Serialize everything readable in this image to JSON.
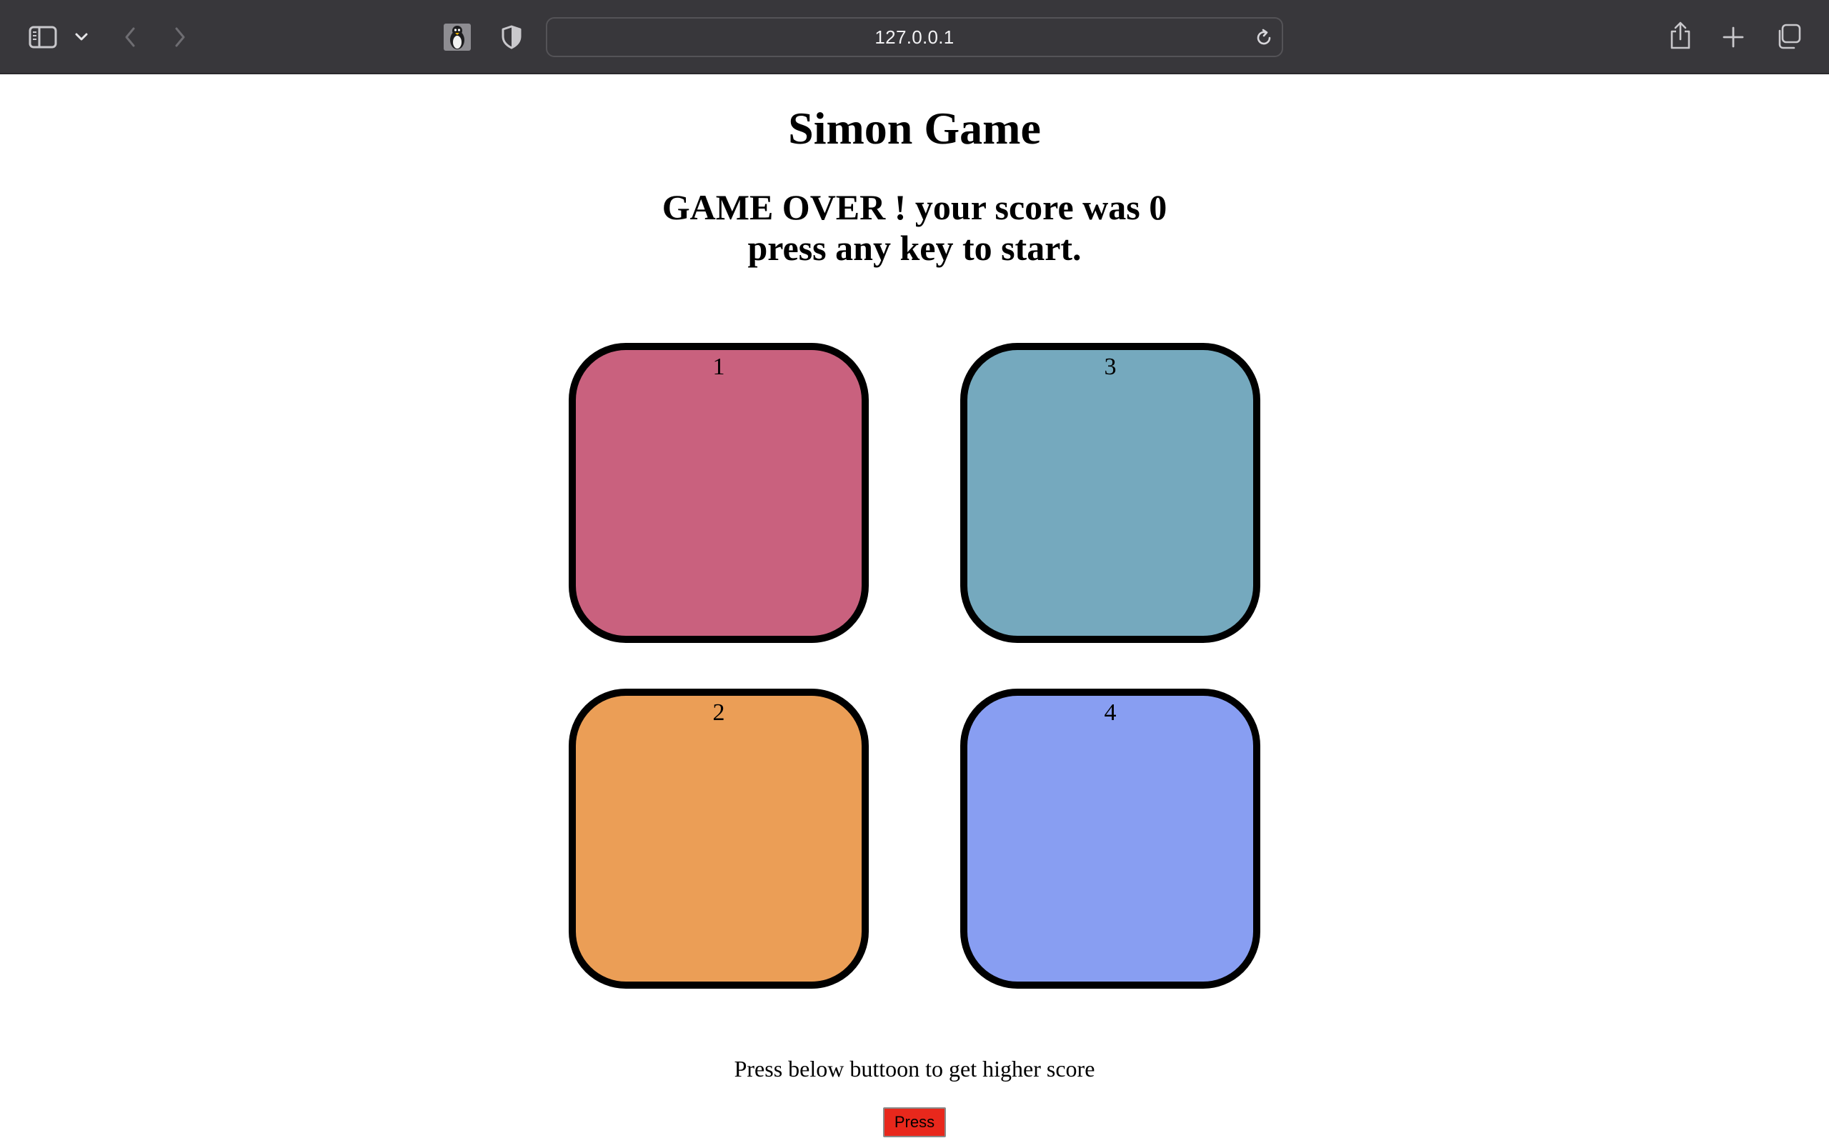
{
  "browser": {
    "url": "127.0.0.1",
    "icons": {
      "sidebar": "sidebar-icon",
      "tab_group_menu": "chevron-down-icon",
      "back": "chevron-left-icon",
      "forward": "chevron-right-icon",
      "site_favicon": "penguin-icon",
      "privacy": "shield-icon",
      "reload": "reload-icon",
      "share": "share-icon",
      "new_tab": "plus-icon",
      "tab_overview": "tabs-icon"
    }
  },
  "game": {
    "title": "Simon Game",
    "status_line1": "GAME OVER ! your score was 0",
    "status_line2": "press any key to start.",
    "pads": [
      {
        "label": "1",
        "color": "#c9617e"
      },
      {
        "label": "2",
        "color": "#eb9e56"
      },
      {
        "label": "3",
        "color": "#75a9be"
      },
      {
        "label": "4",
        "color": "#889ef2"
      }
    ],
    "hint": "Press below buttoon to get higher score",
    "press_button_label": "Press",
    "press_button_color": "#e8281c"
  }
}
